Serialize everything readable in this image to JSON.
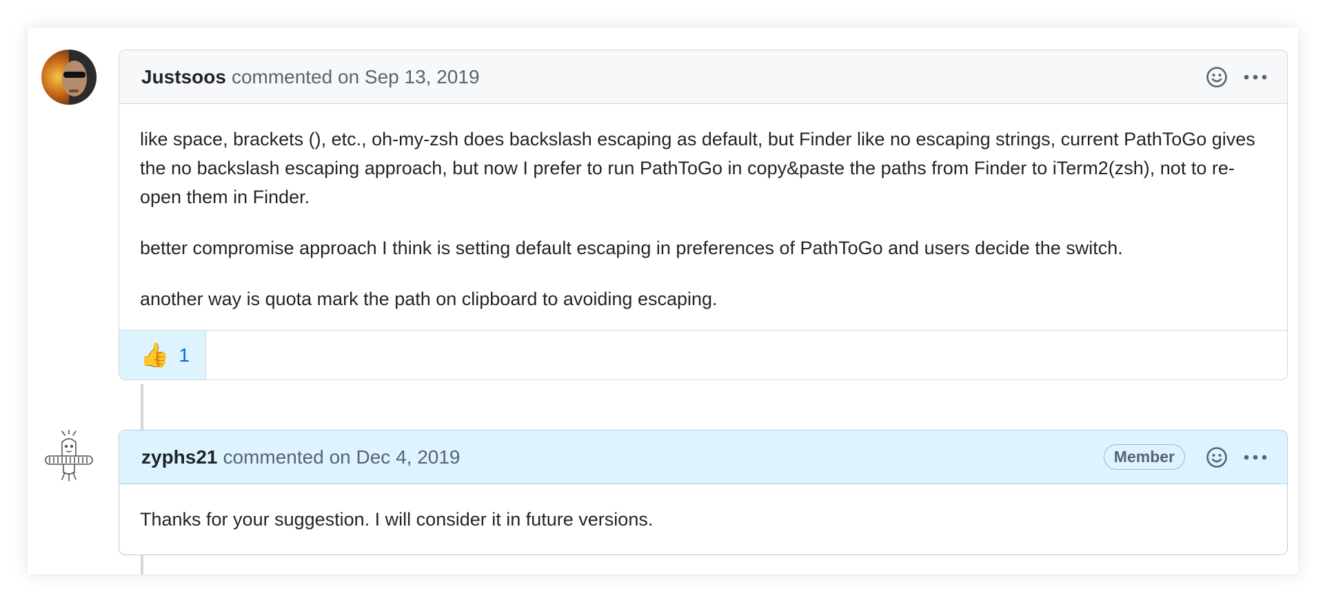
{
  "comments": [
    {
      "author": "Justsoos",
      "meta": "commented on Sep 13, 2019",
      "paragraphs": [
        "like space, brackets (), etc., oh-my-zsh does backslash escaping as default, but Finder like no escaping strings, current PathToGo gives the no backslash escaping approach, but now I prefer to run PathToGo in copy&paste the paths from Finder to iTerm2(zsh), not to re-open them in Finder.",
        "better compromise approach I think is setting default escaping in preferences of PathToGo and users decide the switch.",
        "another way is quota mark the path on clipboard to avoiding escaping."
      ],
      "reaction": {
        "emoji": "👍",
        "count": "1"
      }
    },
    {
      "author": "zyphs21",
      "meta": "commented on Dec 4, 2019",
      "badge": "Member",
      "paragraphs": [
        "Thanks for your suggestion. I will consider it in future versions."
      ]
    }
  ],
  "icons": {
    "emoji_picker": "smiley-icon",
    "more_options": "kebab-horizontal-icon"
  },
  "colors": {
    "link_blue": "#0969da",
    "member_header_bg": "#ddf4ff",
    "header_bg": "#f6f8fa",
    "border": "#d0d7de"
  }
}
